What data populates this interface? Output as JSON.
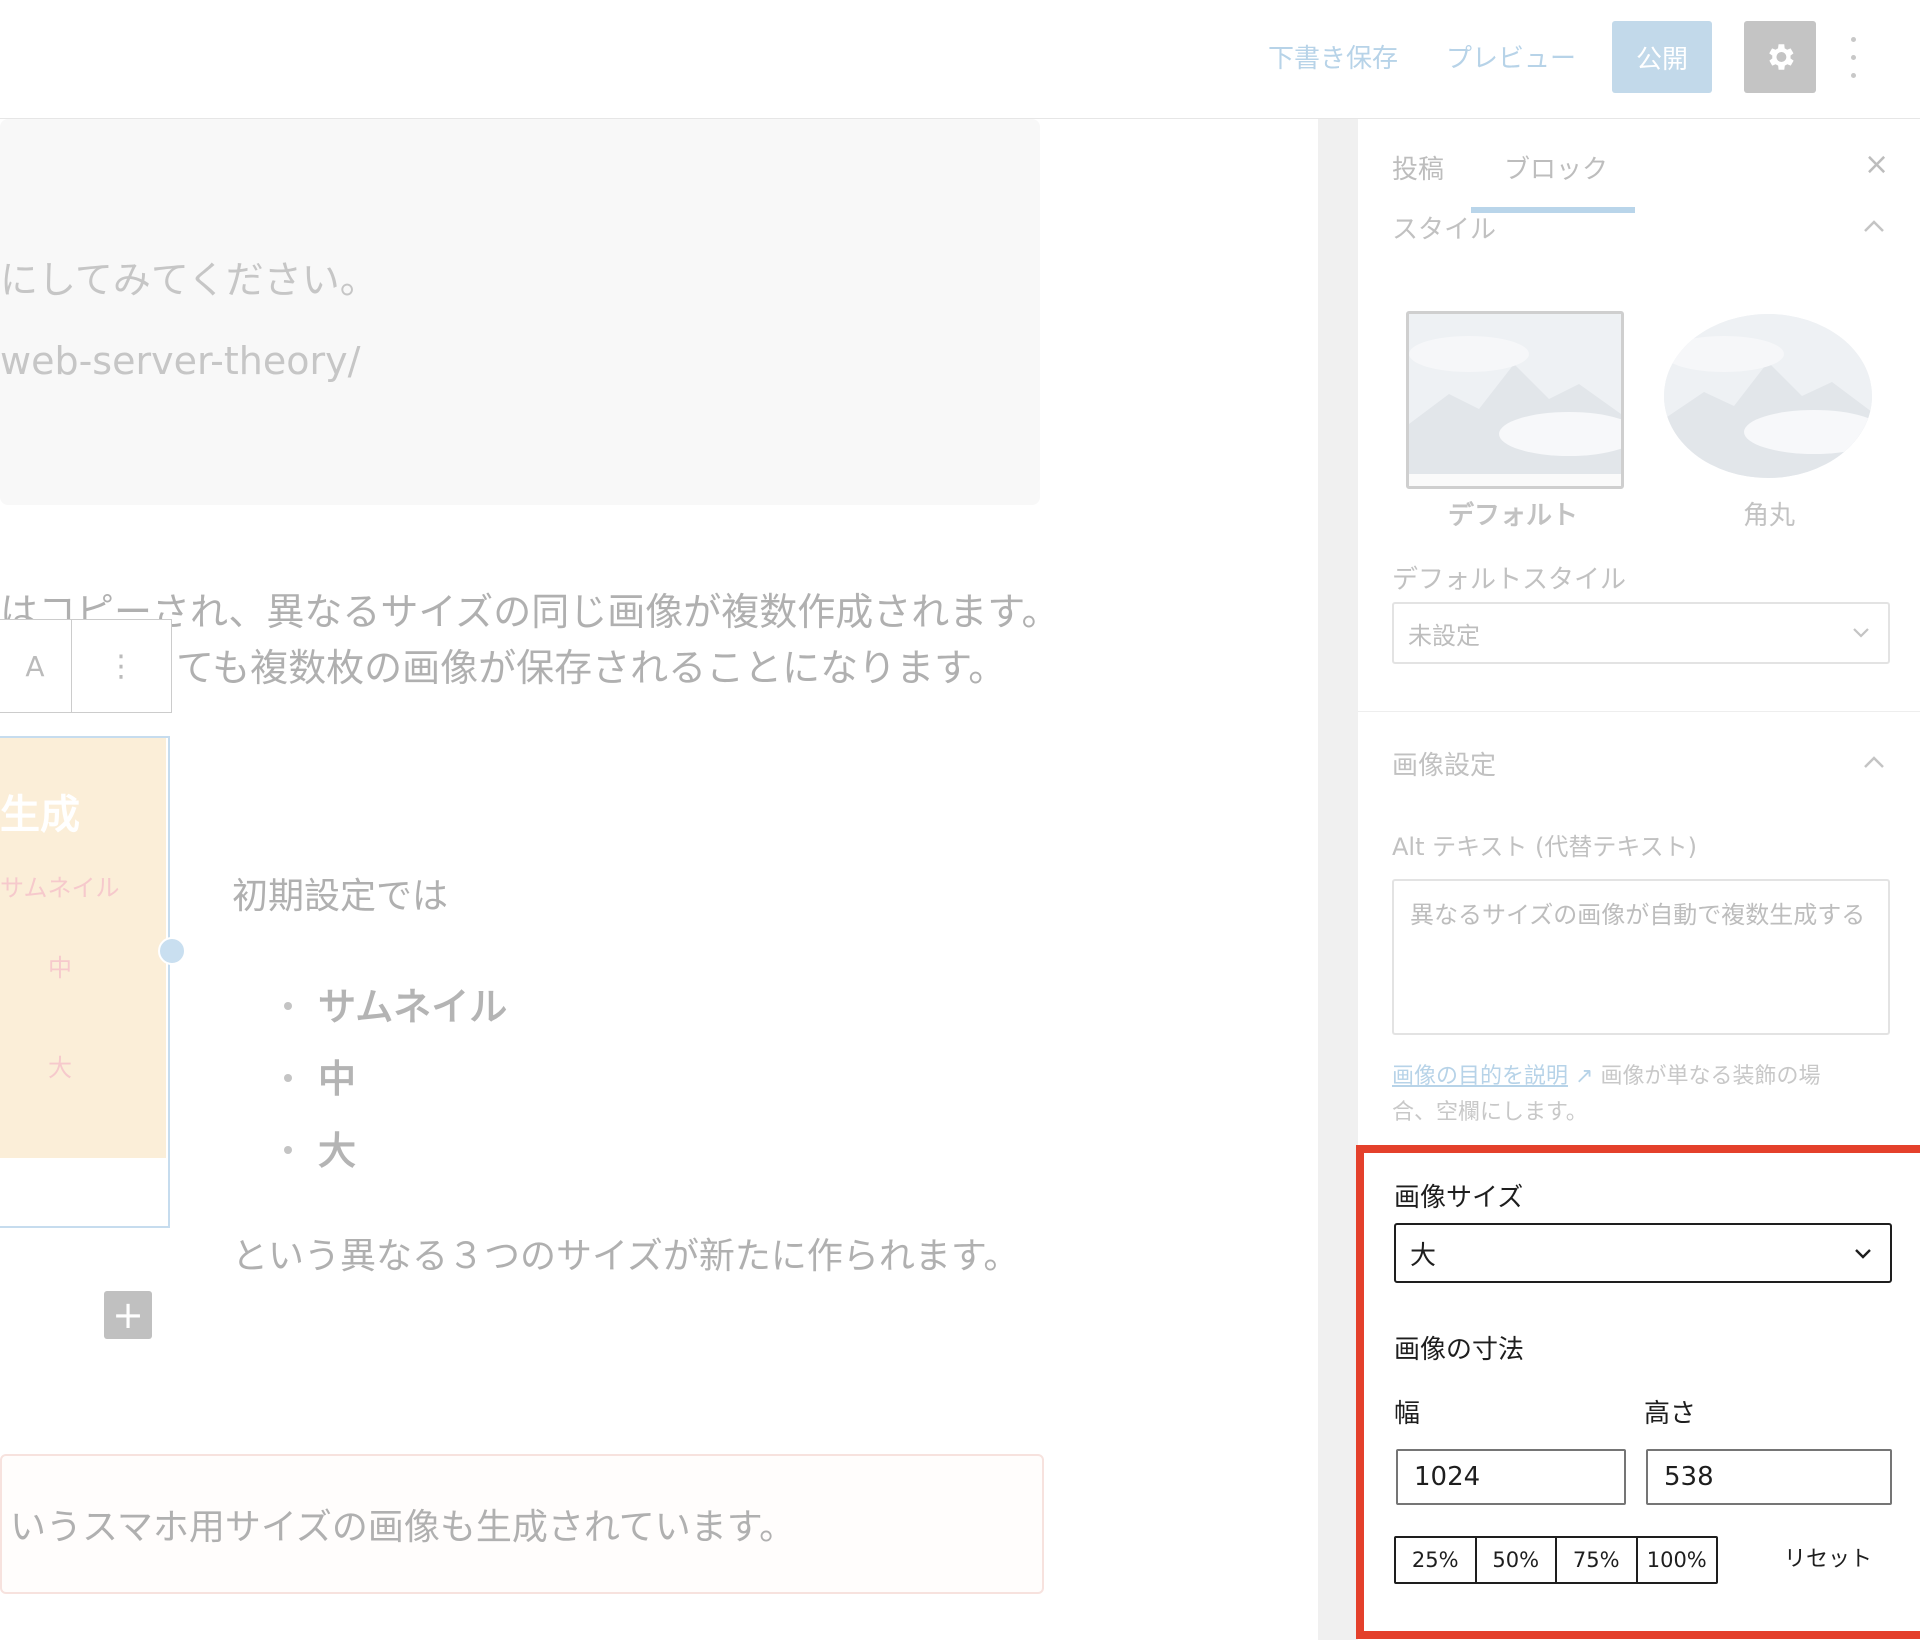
{
  "topbar": {
    "save_draft": "下書き保存",
    "preview": "プレビュー",
    "publish": "公開",
    "settings_icon": "gear-icon",
    "more_icon": "vertical-ellipsis-icon"
  },
  "editor": {
    "code_lines": [
      "にしてみてください。",
      "web-server-theory/"
    ],
    "para1_line1": "はコピーされ、異なるサイズの同じ画像が複数作成されます。",
    "para1_line2": "ても複数枚の画像が保存されることになります。",
    "toolbar_text": "A",
    "toolbar_more": "⋮",
    "image_caption_title": "生成",
    "image_items": [
      "サムネイル",
      "中",
      "大"
    ],
    "intro": "初期設定では",
    "bullets": [
      "サムネイル",
      "中",
      "大"
    ],
    "outro": "という異なる３つのサイズが新たに作られます。",
    "add_block": "+",
    "note": "いうスマホ用サイズの画像も生成されています。"
  },
  "sidebar": {
    "tabs": [
      "投稿",
      "ブロック"
    ],
    "close": "×",
    "style_heading": "スタイル",
    "styles": [
      "デフォルト",
      "角丸"
    ],
    "default_style_label": "デフォルトスタイル",
    "default_style_value": "未設定",
    "image_settings_heading": "画像設定",
    "alt_label": "Alt テキスト (代替テキスト)",
    "alt_value": "異なるサイズの画像が自動で複数生成する",
    "alt_help_link": "画像の目的を説明",
    "alt_help_text_1": "画像が単なる装飾の場",
    "alt_help_text_2": "合、空欄にします。",
    "image_size_label": "画像サイズ",
    "image_size_value": "大",
    "dimensions_label": "画像の寸法",
    "width_label": "幅",
    "height_label": "高さ",
    "width_value": "1024",
    "height_value": "538",
    "percent_buttons": [
      "25%",
      "50%",
      "75%",
      "100%"
    ],
    "reset": "リセット"
  },
  "colors": {
    "highlight": "#e4402b",
    "accent_light": "#c2d9ea"
  }
}
